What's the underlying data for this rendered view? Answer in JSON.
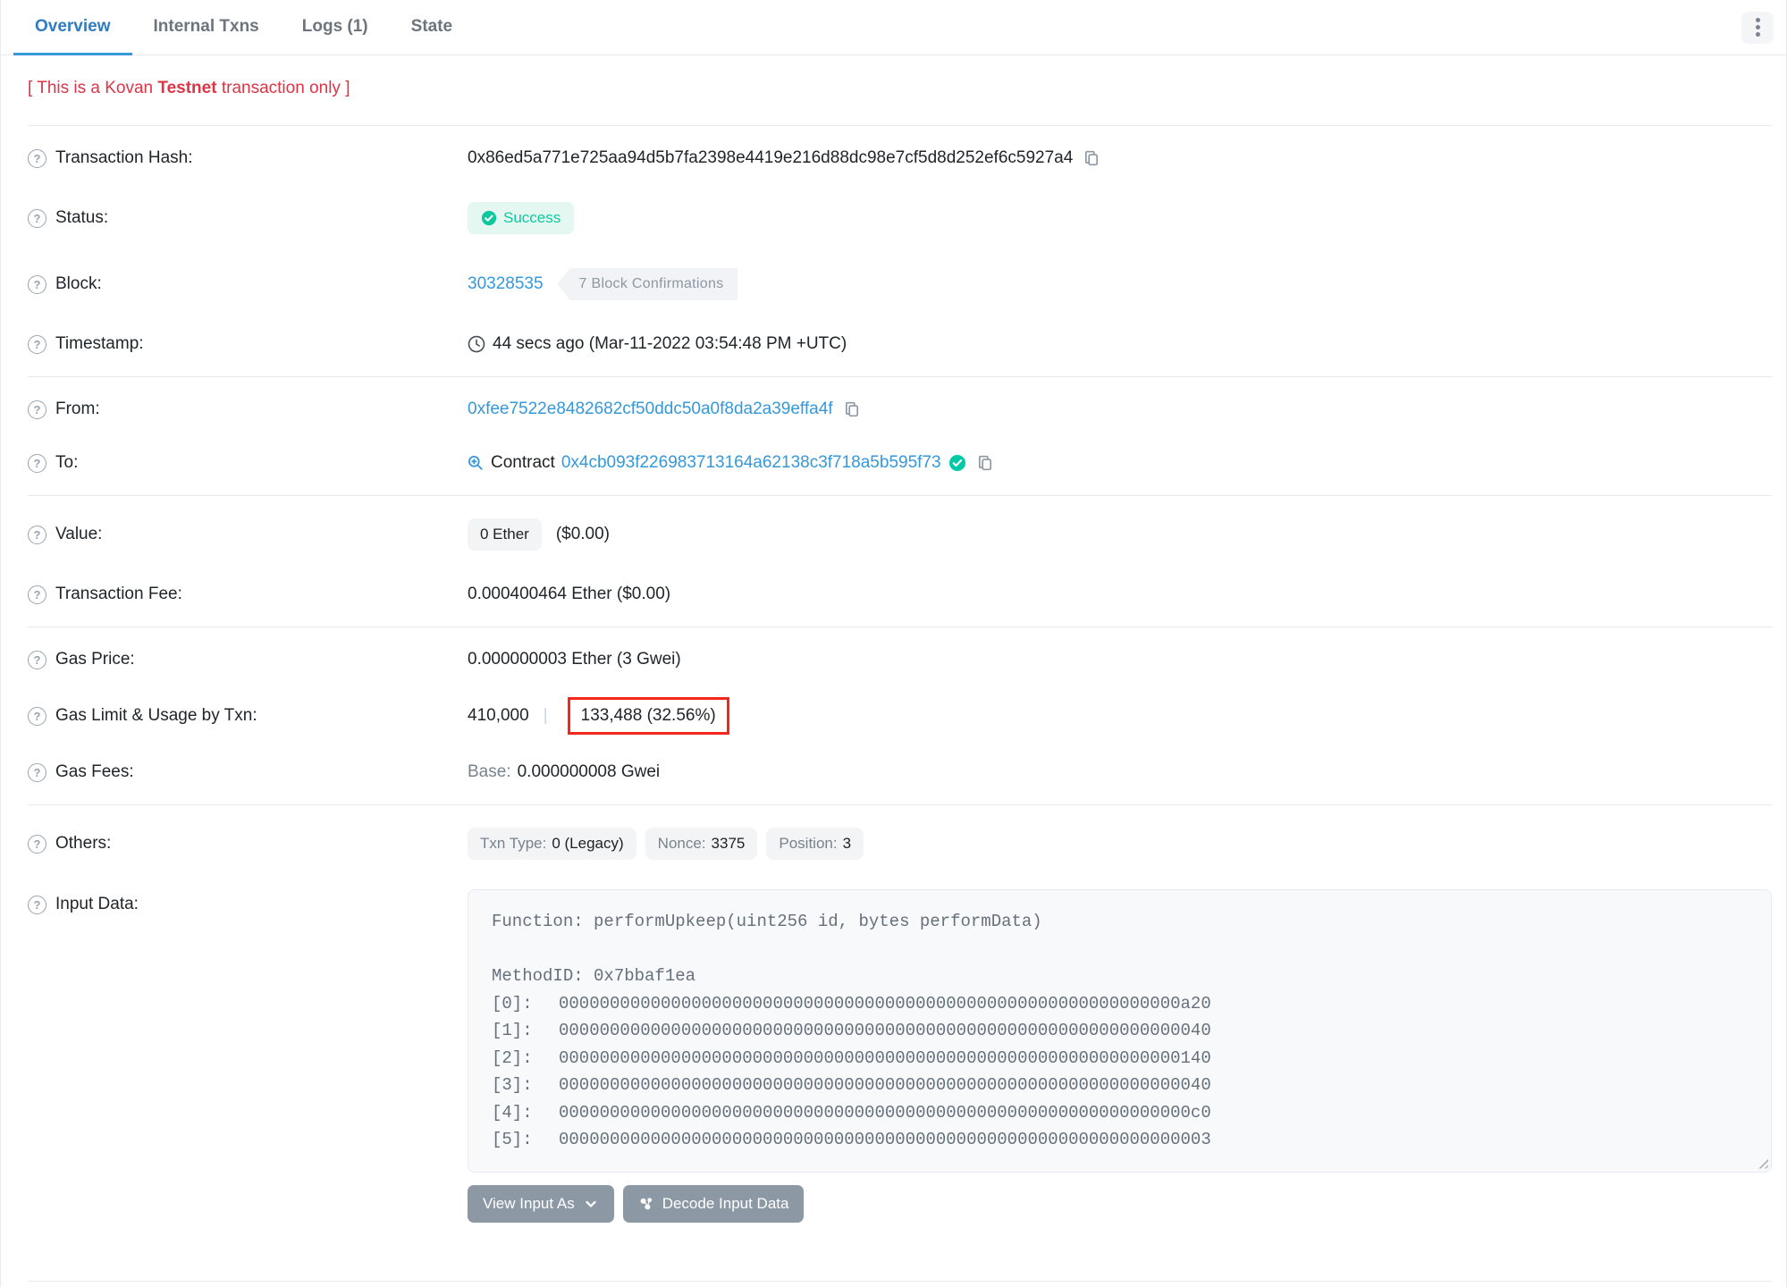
{
  "tabs": [
    {
      "label": "Overview",
      "active": true
    },
    {
      "label": "Internal Txns",
      "active": false
    },
    {
      "label": "Logs (1)",
      "active": false
    },
    {
      "label": "State",
      "active": false
    }
  ],
  "notice": {
    "prefix": "[ This is a Kovan ",
    "bold": "Testnet",
    "suffix": " transaction only ]"
  },
  "rows": {
    "transaction_hash": {
      "label": "Transaction Hash:",
      "value": "0x86ed5a771e725aa94d5b7fa2398e4419e216d88dc98e7cf5d8d252ef6c5927a4"
    },
    "status": {
      "label": "Status:",
      "value": "Success"
    },
    "block": {
      "label": "Block:",
      "number": "30328535",
      "confirmations": "7 Block Confirmations"
    },
    "timestamp": {
      "label": "Timestamp:",
      "value": "44 secs ago (Mar-11-2022 03:54:48 PM +UTC)"
    },
    "from": {
      "label": "From:",
      "address": "0xfee7522e8482682cf50ddc50a0f8da2a39effa4f"
    },
    "to": {
      "label": "To:",
      "type_word": "Contract",
      "address": "0x4cb093f226983713164a62138c3f718a5b595f73"
    },
    "value": {
      "label": "Value:",
      "badge": "0 Ether",
      "usd": "($0.00)"
    },
    "transaction_fee": {
      "label": "Transaction Fee:",
      "value": "0.000400464 Ether ($0.00)"
    },
    "gas_price": {
      "label": "Gas Price:",
      "value": "0.000000003 Ether (3 Gwei)"
    },
    "gas_limit": {
      "label": "Gas Limit & Usage by Txn:",
      "limit": "410,000",
      "separator": "|",
      "usage": "133,488 (32.56%)"
    },
    "gas_fees": {
      "label": "Gas Fees:",
      "base_label": "Base:",
      "base_value": "0.000000008 Gwei"
    },
    "others": {
      "label": "Others:",
      "badges": [
        {
          "key": "Txn Type:",
          "value": "0 (Legacy)"
        },
        {
          "key": "Nonce:",
          "value": "3375"
        },
        {
          "key": "Position:",
          "value": "3"
        }
      ]
    },
    "input_data": {
      "label": "Input Data:",
      "function_line": "Function: performUpkeep(uint256 id, bytes performData)",
      "method_id_line": "MethodID: 0x7bbaf1ea",
      "lines": [
        {
          "idx": "[0]:",
          "hex": "0000000000000000000000000000000000000000000000000000000000000a20"
        },
        {
          "idx": "[1]:",
          "hex": "0000000000000000000000000000000000000000000000000000000000000040"
        },
        {
          "idx": "[2]:",
          "hex": "0000000000000000000000000000000000000000000000000000000000000140"
        },
        {
          "idx": "[3]:",
          "hex": "0000000000000000000000000000000000000000000000000000000000000040"
        },
        {
          "idx": "[4]:",
          "hex": "00000000000000000000000000000000000000000000000000000000000000c0"
        },
        {
          "idx": "[5]:",
          "hex": "0000000000000000000000000000000000000000000000000000000000000003"
        }
      ]
    }
  },
  "buttons": {
    "view_input_as": "View Input As",
    "decode_input_data": "Decode Input Data"
  },
  "colors": {
    "accent_blue": "#3498db",
    "notice_red": "#dc3545",
    "success_teal": "#10c8a0",
    "verified_green": "#00c9a7",
    "highlight_box_red": "#f5271a",
    "button_gray": "#8c98a4"
  }
}
